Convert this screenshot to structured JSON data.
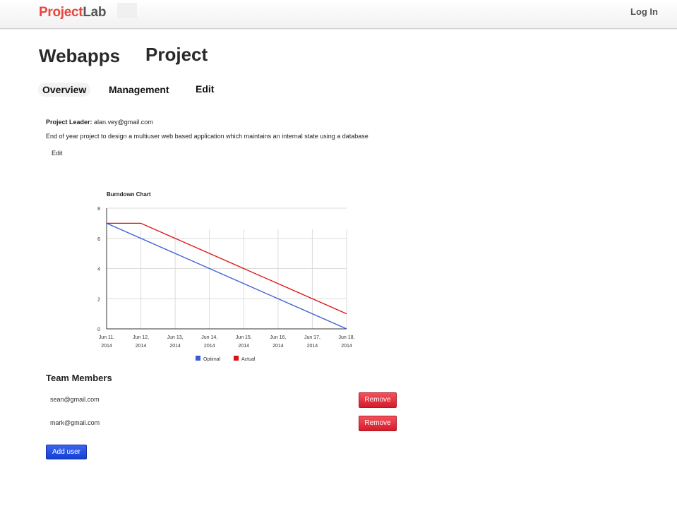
{
  "header": {
    "brand_part1": "Project",
    "brand_part2": "Lab",
    "login_label": "Log In"
  },
  "page": {
    "title_word1": "Webapps",
    "title_word2": "Project"
  },
  "tabs": [
    {
      "label": "Overview",
      "active": true
    },
    {
      "label": "Management",
      "active": false
    },
    {
      "label": "Edit",
      "active": false
    }
  ],
  "project": {
    "leader_label": "Project Leader:",
    "leader_email": "alan.vey@gmail.com",
    "description": "End of year project to design a multiuser web based application which maintains an internal state using a database",
    "edit_label": "Edit"
  },
  "chart_data": {
    "type": "line",
    "title": "Burndown Chart",
    "x": [
      "Jun 11, 2014",
      "Jun 12, 2014",
      "Jun 13, 2014",
      "Jun 14, 2014",
      "Jun 15, 2014",
      "Jun 16, 2014",
      "Jun 17, 2014",
      "Jun 18, 2014"
    ],
    "series": [
      {
        "name": "Optimal",
        "color": "#3b5bd6",
        "values": [
          7,
          6,
          5,
          4,
          3,
          2,
          1,
          0
        ]
      },
      {
        "name": "Actual",
        "color": "#dd1111",
        "values": [
          7,
          7,
          6,
          5,
          4,
          3,
          2,
          1
        ]
      }
    ],
    "ylim": [
      0,
      8
    ],
    "yticks": [
      0,
      2,
      4,
      6,
      8
    ],
    "grid": true,
    "legend_position": "bottom"
  },
  "team": {
    "title": "Team Members",
    "members": [
      {
        "email": "sean@gmail.com",
        "action": "Remove"
      },
      {
        "email": "mark@gmail.com",
        "action": "Remove"
      }
    ],
    "add_label": "Add user"
  },
  "colors": {
    "brand_red": "#e8453c",
    "remove_red": "#d41c2a",
    "add_blue": "#1640d2"
  }
}
